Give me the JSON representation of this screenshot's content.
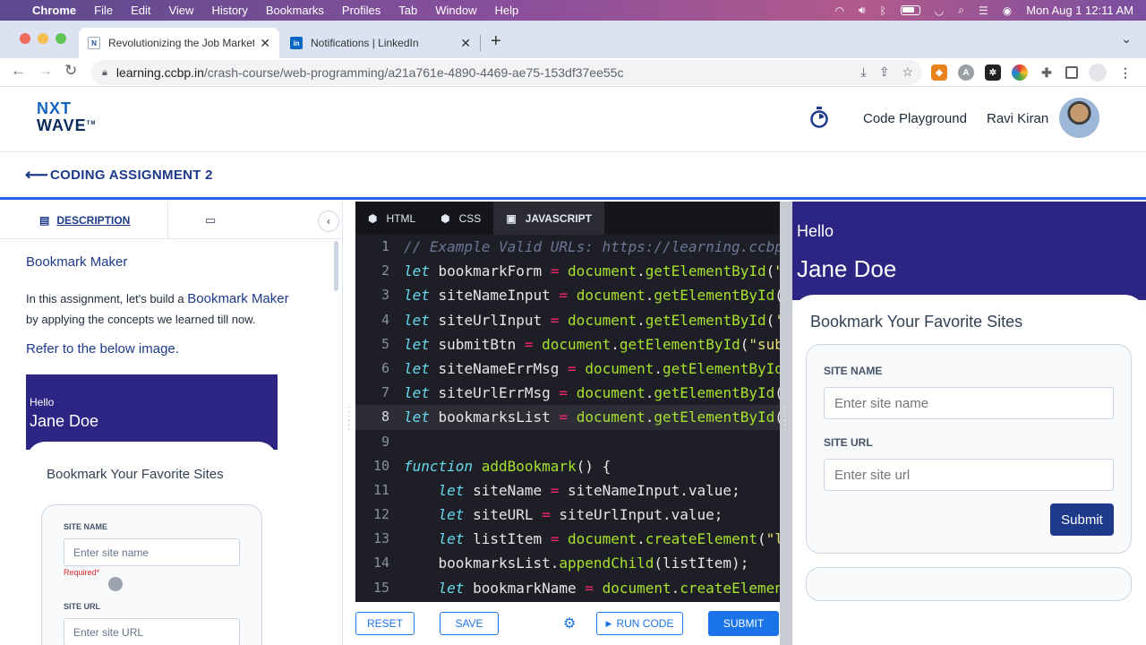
{
  "menubar": {
    "app": "Chrome",
    "items": [
      "File",
      "Edit",
      "View",
      "History",
      "Bookmarks",
      "Profiles",
      "Tab",
      "Window",
      "Help"
    ],
    "datetime": "Mon Aug 1  12:11 AM"
  },
  "tabs": [
    {
      "title": "Revolutionizing the Job Market",
      "favicon": "nxtwave-icon"
    },
    {
      "title": "Notifications | LinkedIn",
      "favicon": "linkedin-icon"
    }
  ],
  "address": {
    "host": "learning.ccbp.in",
    "path": "/crash-course/web-programming/a21a761e-4890-4469-ae75-153df37ee55c"
  },
  "header": {
    "logo_line1": "NXT",
    "logo_line2": "WAVE",
    "logo_tm": "TM",
    "playground": "Code Playground",
    "user": "Ravi Kiran"
  },
  "assignment": {
    "title": "CODING ASSIGNMENT 2"
  },
  "description": {
    "tab_label": "DESCRIPTION",
    "heading": "Bookmark Maker",
    "intro_pre": "In this assignment, let's build a ",
    "intro_highlight": "Bookmark Maker",
    "intro_post": "by applying the concepts we learned till now.",
    "refer": "Refer to the below image."
  },
  "preview_image": {
    "hello": "Hello",
    "name": "Jane Doe",
    "card_title": "Bookmark Your Favorite Sites",
    "site_name_label": "SITE NAME",
    "site_name_placeholder": "Enter site name",
    "required": "Required*",
    "site_url_label": "SITE URL",
    "site_url_placeholder": "Enter site URL"
  },
  "editor": {
    "tabs": [
      "HTML",
      "CSS",
      "JAVASCRIPT"
    ],
    "active_tab": "JAVASCRIPT",
    "current_line": 8
  },
  "editor_buttons": {
    "reset": "RESET",
    "save": "SAVE",
    "run": "RUN CODE",
    "submit": "SUBMIT"
  },
  "preview": {
    "hello": "Hello",
    "name": "Jane Doe",
    "card_title": "Bookmark Your Favorite Sites",
    "site_name_label": "SITE NAME",
    "site_name_placeholder": "Enter site name",
    "site_url_label": "SITE URL",
    "site_url_placeholder": "Enter site url",
    "submit": "Submit"
  },
  "colors": {
    "brand": "#1e3a8a",
    "accent": "#1a73e8",
    "preview_header": "#2c2584"
  }
}
